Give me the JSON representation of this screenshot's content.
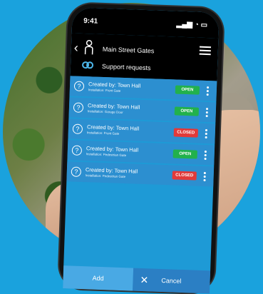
{
  "status": {
    "time": "9:41"
  },
  "header": {
    "title": "Main Street Gates",
    "subtitle": "Support requests"
  },
  "requests": [
    {
      "created": "Created by: Town Hall",
      "installation": "Installation: Front Gate",
      "status": "OPEN",
      "status_color": "#22b14c"
    },
    {
      "created": "Created by: Town Hall",
      "installation": "Installation: Garage Door",
      "status": "OPEN",
      "status_color": "#22b14c"
    },
    {
      "created": "Created by: Town Hall",
      "installation": "Installation: Front Gate",
      "status": "CLOSED",
      "status_color": "#e23a3a"
    },
    {
      "created": "Created by: Town Hall",
      "installation": "Installation: Pedestrian Gate",
      "status": "OPEN",
      "status_color": "#22b14c"
    },
    {
      "created": "Created by: Town Hall",
      "installation": "Installation: Pedestrian Gate",
      "status": "CLOSED",
      "status_color": "#e23a3a"
    }
  ],
  "footer": {
    "add_label": "Add",
    "cancel_label": "Cancel"
  }
}
